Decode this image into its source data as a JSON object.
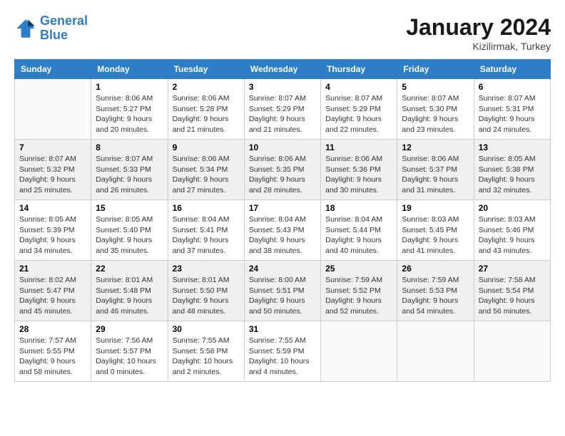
{
  "logo": {
    "line1": "General",
    "line2": "Blue"
  },
  "title": "January 2024",
  "subtitle": "Kizilirmak, Turkey",
  "days_of_week": [
    "Sunday",
    "Monday",
    "Tuesday",
    "Wednesday",
    "Thursday",
    "Friday",
    "Saturday"
  ],
  "weeks": [
    [
      {
        "day": "",
        "info": ""
      },
      {
        "day": "1",
        "info": "Sunrise: 8:06 AM\nSunset: 5:27 PM\nDaylight: 9 hours\nand 20 minutes."
      },
      {
        "day": "2",
        "info": "Sunrise: 8:06 AM\nSunset: 5:28 PM\nDaylight: 9 hours\nand 21 minutes."
      },
      {
        "day": "3",
        "info": "Sunrise: 8:07 AM\nSunset: 5:29 PM\nDaylight: 9 hours\nand 21 minutes."
      },
      {
        "day": "4",
        "info": "Sunrise: 8:07 AM\nSunset: 5:29 PM\nDaylight: 9 hours\nand 22 minutes."
      },
      {
        "day": "5",
        "info": "Sunrise: 8:07 AM\nSunset: 5:30 PM\nDaylight: 9 hours\nand 23 minutes."
      },
      {
        "day": "6",
        "info": "Sunrise: 8:07 AM\nSunset: 5:31 PM\nDaylight: 9 hours\nand 24 minutes."
      }
    ],
    [
      {
        "day": "7",
        "info": "Sunrise: 8:07 AM\nSunset: 5:32 PM\nDaylight: 9 hours\nand 25 minutes."
      },
      {
        "day": "8",
        "info": "Sunrise: 8:07 AM\nSunset: 5:33 PM\nDaylight: 9 hours\nand 26 minutes."
      },
      {
        "day": "9",
        "info": "Sunrise: 8:06 AM\nSunset: 5:34 PM\nDaylight: 9 hours\nand 27 minutes."
      },
      {
        "day": "10",
        "info": "Sunrise: 8:06 AM\nSunset: 5:35 PM\nDaylight: 9 hours\nand 28 minutes."
      },
      {
        "day": "11",
        "info": "Sunrise: 8:06 AM\nSunset: 5:36 PM\nDaylight: 9 hours\nand 30 minutes."
      },
      {
        "day": "12",
        "info": "Sunrise: 8:06 AM\nSunset: 5:37 PM\nDaylight: 9 hours\nand 31 minutes."
      },
      {
        "day": "13",
        "info": "Sunrise: 8:05 AM\nSunset: 5:38 PM\nDaylight: 9 hours\nand 32 minutes."
      }
    ],
    [
      {
        "day": "14",
        "info": "Sunrise: 8:05 AM\nSunset: 5:39 PM\nDaylight: 9 hours\nand 34 minutes."
      },
      {
        "day": "15",
        "info": "Sunrise: 8:05 AM\nSunset: 5:40 PM\nDaylight: 9 hours\nand 35 minutes."
      },
      {
        "day": "16",
        "info": "Sunrise: 8:04 AM\nSunset: 5:41 PM\nDaylight: 9 hours\nand 37 minutes."
      },
      {
        "day": "17",
        "info": "Sunrise: 8:04 AM\nSunset: 5:43 PM\nDaylight: 9 hours\nand 38 minutes."
      },
      {
        "day": "18",
        "info": "Sunrise: 8:04 AM\nSunset: 5:44 PM\nDaylight: 9 hours\nand 40 minutes."
      },
      {
        "day": "19",
        "info": "Sunrise: 8:03 AM\nSunset: 5:45 PM\nDaylight: 9 hours\nand 41 minutes."
      },
      {
        "day": "20",
        "info": "Sunrise: 8:03 AM\nSunset: 5:46 PM\nDaylight: 9 hours\nand 43 minutes."
      }
    ],
    [
      {
        "day": "21",
        "info": "Sunrise: 8:02 AM\nSunset: 5:47 PM\nDaylight: 9 hours\nand 45 minutes."
      },
      {
        "day": "22",
        "info": "Sunrise: 8:01 AM\nSunset: 5:48 PM\nDaylight: 9 hours\nand 46 minutes."
      },
      {
        "day": "23",
        "info": "Sunrise: 8:01 AM\nSunset: 5:50 PM\nDaylight: 9 hours\nand 48 minutes."
      },
      {
        "day": "24",
        "info": "Sunrise: 8:00 AM\nSunset: 5:51 PM\nDaylight: 9 hours\nand 50 minutes."
      },
      {
        "day": "25",
        "info": "Sunrise: 7:59 AM\nSunset: 5:52 PM\nDaylight: 9 hours\nand 52 minutes."
      },
      {
        "day": "26",
        "info": "Sunrise: 7:59 AM\nSunset: 5:53 PM\nDaylight: 9 hours\nand 54 minutes."
      },
      {
        "day": "27",
        "info": "Sunrise: 7:58 AM\nSunset: 5:54 PM\nDaylight: 9 hours\nand 56 minutes."
      }
    ],
    [
      {
        "day": "28",
        "info": "Sunrise: 7:57 AM\nSunset: 5:55 PM\nDaylight: 9 hours\nand 58 minutes."
      },
      {
        "day": "29",
        "info": "Sunrise: 7:56 AM\nSunset: 5:57 PM\nDaylight: 10 hours\nand 0 minutes."
      },
      {
        "day": "30",
        "info": "Sunrise: 7:55 AM\nSunset: 5:58 PM\nDaylight: 10 hours\nand 2 minutes."
      },
      {
        "day": "31",
        "info": "Sunrise: 7:55 AM\nSunset: 5:59 PM\nDaylight: 10 hours\nand 4 minutes."
      },
      {
        "day": "",
        "info": ""
      },
      {
        "day": "",
        "info": ""
      },
      {
        "day": "",
        "info": ""
      }
    ]
  ]
}
